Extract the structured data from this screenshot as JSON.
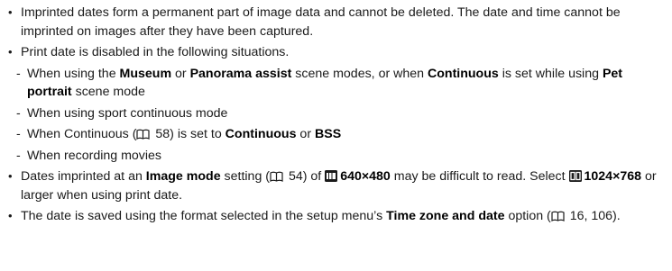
{
  "bullets": [
    {
      "text": "Imprinted dates form a permanent part of image data and cannot be deleted. The date and time cannot be imprinted on images after they have been captured."
    },
    {
      "text": "Print date is disabled in the following situations.",
      "subitems": {
        "s1_a": "When using the ",
        "s1_museum": "Museum",
        "s1_b": " or ",
        "s1_panorama": "Panorama assist",
        "s1_c": " scene modes, or when ",
        "s1_continuous": "Continuous",
        "s1_d": " is set while using ",
        "s1_pet": "Pet portrait",
        "s1_e": " scene mode",
        "s2": "When using sport continuous mode",
        "s3_a": "When Continuous (",
        "s3_ref": " 58) is set to ",
        "s3_continuous": "Continuous",
        "s3_or": " or ",
        "s3_bss": "BSS",
        "s4": "When recording movies"
      }
    },
    {
      "p_a": "Dates imprinted at an ",
      "p_image_mode": "Image mode",
      "p_b": " setting (",
      "p_ref": " 54) of ",
      "p_size1": "640×480",
      "p_c": " may be difficult to read. Select ",
      "p_size2": "1024×768",
      "p_d": " or larger when using print date."
    },
    {
      "p_a": "The date is saved using the format selected in the setup menu’s ",
      "p_option": "Time zone and date",
      "p_b": " option (",
      "p_ref": " 16, 106)."
    }
  ],
  "icons": {
    "reference": "book-reference-icon",
    "vga": "vga-image-mode-icon",
    "pc": "pc-image-mode-icon"
  },
  "colors": {
    "text": "#1a1a1a",
    "bold": "#000000"
  }
}
